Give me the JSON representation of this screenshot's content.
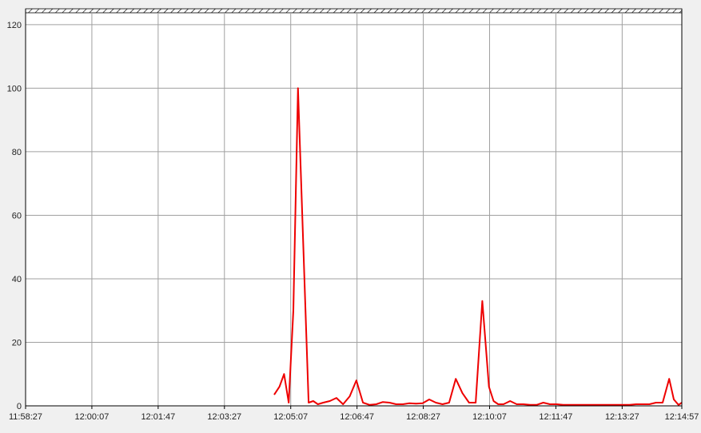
{
  "chart_data": {
    "type": "line",
    "title": "",
    "xlabel": "",
    "ylabel": "",
    "ylim": [
      0,
      125
    ],
    "yticks": [
      0,
      20,
      40,
      60,
      80,
      100,
      120
    ],
    "ytick_labels": [
      "0",
      "20",
      "40",
      "60",
      "80",
      "100",
      "120"
    ],
    "xlim": [
      "11:58:27",
      "12:14:57"
    ],
    "xtick_labels": [
      "11:58:27",
      "12:00:07",
      "12:01:47",
      "12:03:27",
      "12:05:07",
      "12:06:47",
      "12:08:27",
      "12:10:07",
      "12:11:47",
      "12:13:27",
      "12:14:57"
    ],
    "grid": true,
    "legend": "none",
    "series": [
      {
        "color": "#ee0000",
        "x": [
          "12:04:42",
          "12:04:50",
          "12:04:57",
          "12:05:04",
          "12:05:11",
          "12:05:18",
          "12:05:26",
          "12:05:34",
          "12:05:41",
          "12:05:48",
          "12:05:56",
          "12:06:06",
          "12:06:16",
          "12:06:26",
          "12:06:36",
          "12:06:46",
          "12:06:56",
          "12:07:06",
          "12:07:16",
          "12:07:26",
          "12:07:36",
          "12:07:46",
          "12:07:56",
          "12:08:06",
          "12:08:16",
          "12:08:26",
          "12:08:36",
          "12:08:46",
          "12:08:56",
          "12:09:06",
          "12:09:16",
          "12:09:26",
          "12:09:36",
          "12:09:46",
          "12:09:56",
          "12:10:06",
          "12:10:13",
          "12:10:20",
          "12:10:28",
          "12:10:38",
          "12:10:48",
          "12:10:58",
          "12:11:08",
          "12:11:18",
          "12:11:28",
          "12:11:38",
          "12:11:48",
          "12:11:58",
          "12:12:08",
          "12:12:18",
          "12:12:28",
          "12:12:38",
          "12:12:48",
          "12:12:58",
          "12:13:08",
          "12:13:18",
          "12:13:28",
          "12:13:38",
          "12:13:48",
          "12:13:58",
          "12:14:08",
          "12:14:18",
          "12:14:28",
          "12:14:38",
          "12:14:45",
          "12:14:52",
          "12:14:57"
        ],
        "y": [
          3.5,
          6,
          10,
          1,
          30,
          100,
          50,
          1,
          1.5,
          0.5,
          1,
          1.5,
          2.5,
          0.5,
          3,
          8,
          1,
          0.3,
          0.5,
          1.2,
          1,
          0.5,
          0.5,
          0.8,
          0.7,
          0.8,
          2,
          1,
          0.5,
          1,
          8.5,
          4,
          1,
          1,
          33,
          6,
          1.5,
          0.5,
          0.5,
          1.5,
          0.5,
          0.5,
          0.3,
          0.3,
          1,
          0.5,
          0.5,
          0.3,
          0.3,
          0.3,
          0.3,
          0.3,
          0.3,
          0.3,
          0.3,
          0.3,
          0.3,
          0.3,
          0.5,
          0.5,
          0.5,
          1,
          1,
          8.5,
          2,
          0.3,
          1
        ]
      }
    ]
  }
}
